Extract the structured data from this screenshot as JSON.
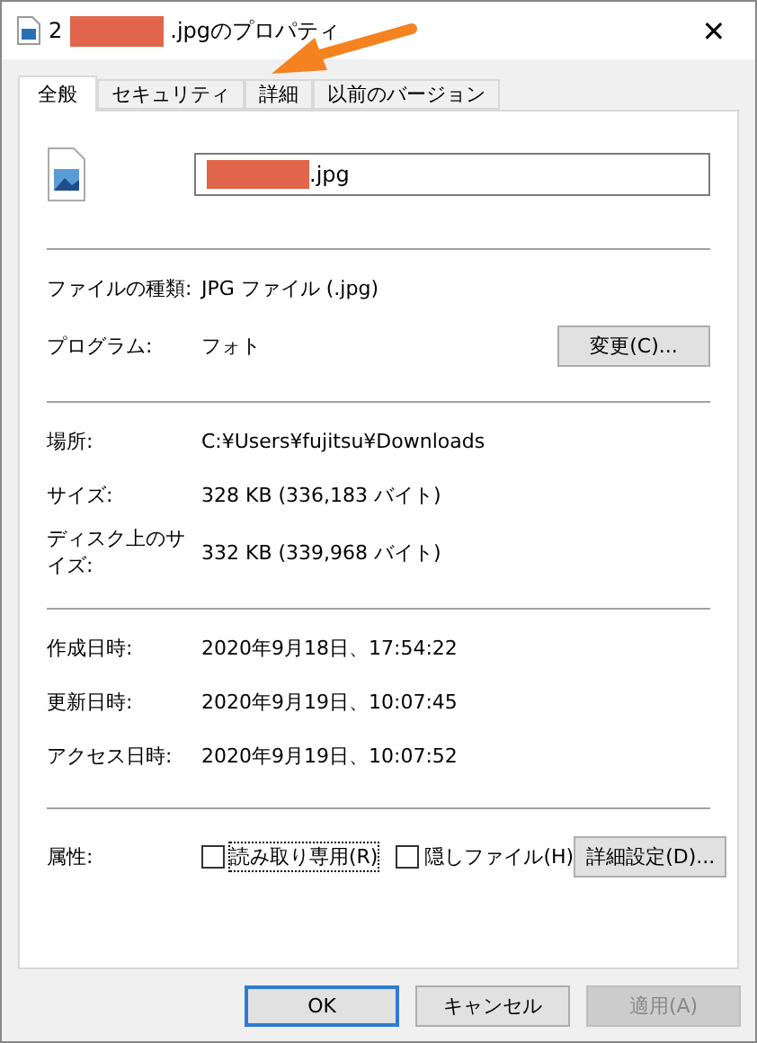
{
  "window": {
    "title_start": "2",
    "title_end": ".jpgのプロパティ",
    "close": "✕"
  },
  "tabs": [
    {
      "label": "全般",
      "selected": true
    },
    {
      "label": "セキュリティ",
      "selected": false
    },
    {
      "label": "詳細",
      "selected": false
    },
    {
      "label": "以前のバージョン",
      "selected": false
    }
  ],
  "file_name": {
    "value": ".jpg"
  },
  "sections": [
    [
      {
        "label": "ファイルの種類:",
        "value": "JPG ファイル (.jpg)"
      },
      {
        "label": "プログラム:",
        "value": "フォト",
        "button": "変更(C)..."
      }
    ],
    [
      {
        "label": "場所:",
        "value": "C:¥Users¥fujitsu¥Downloads"
      },
      {
        "label": "サイズ:",
        "value": "328 KB (336,183 バイト)"
      },
      {
        "label": "ディスク上のサイズ:",
        "value": "332 KB (339,968 バイト)"
      }
    ],
    [
      {
        "label": "作成日時:",
        "value": "2020年9月18日、17:54:22"
      },
      {
        "label": "更新日時:",
        "value": "2020年9月19日、10:07:45"
      },
      {
        "label": "アクセス日時:",
        "value": "2020年9月19日、10:07:52"
      }
    ]
  ],
  "attributes": {
    "label": "属性:",
    "checkboxes": [
      {
        "label": "読み取り専用(R)",
        "checked": false,
        "focused": true
      },
      {
        "label": "隠しファイル(H)",
        "checked": false,
        "focused": false
      }
    ],
    "button": "詳細設定(D)..."
  },
  "buttons": [
    {
      "label": "OK",
      "default": true,
      "disabled": false
    },
    {
      "label": "キャンセル",
      "default": false,
      "disabled": false
    },
    {
      "label": "適用(A)",
      "default": false,
      "disabled": true
    }
  ]
}
